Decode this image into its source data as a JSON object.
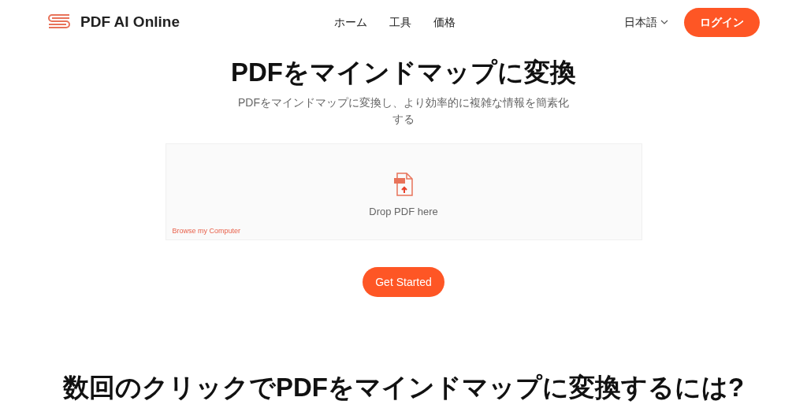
{
  "header": {
    "brand": "PDF AI Online",
    "nav": [
      "ホーム",
      "工具",
      "価格"
    ],
    "language": "日本語",
    "login": "ログイン"
  },
  "hero": {
    "title": "PDFをマインドマップに変換",
    "subtitle": "PDFをマインドマップに変換し、より効率的に複雑な情報を簡素化する",
    "dropzone": {
      "hint": "Drop PDF here",
      "browse": "Browse my Computer"
    },
    "cta": "Get Started"
  },
  "section_title": "数回のクリックでPDFをマインドマップに変換するには?"
}
